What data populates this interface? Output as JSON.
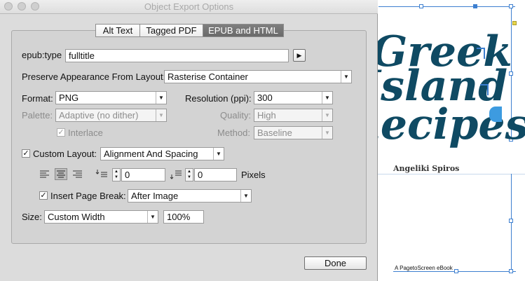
{
  "window": {
    "title": "Object Export Options"
  },
  "tabs": [
    {
      "label": "Alt Text"
    },
    {
      "label": "Tagged PDF"
    },
    {
      "label": "EPUB and HTML"
    }
  ],
  "epub_type": {
    "label": "epub:type",
    "value": "fulltitle"
  },
  "preserve": {
    "label": "Preserve Appearance From Layout:",
    "value": "Rasterise Container"
  },
  "format": {
    "label": "Format:",
    "value": "PNG"
  },
  "resolution": {
    "label": "Resolution (ppi):",
    "value": "300"
  },
  "palette": {
    "label": "Palette:",
    "value": "Adaptive (no dither)"
  },
  "quality": {
    "label": "Quality:",
    "value": "High"
  },
  "interlace": {
    "label": "Interlace",
    "checked": true
  },
  "method": {
    "label": "Method:",
    "value": "Baseline"
  },
  "custom_layout": {
    "label": "Custom Layout:",
    "checked": true,
    "value": "Alignment And Spacing"
  },
  "spacing": {
    "before": "0",
    "after": "0",
    "unit": "Pixels"
  },
  "page_break": {
    "label": "Insert Page Break:",
    "checked": true,
    "value": "After Image"
  },
  "size": {
    "label": "Size:",
    "value": "Custom Width",
    "percent": "100%"
  },
  "buttons": {
    "done": "Done"
  },
  "canvas": {
    "title_lines": [
      "Greek",
      "Island",
      "Recipes"
    ],
    "author": "Angeliki Spiros",
    "footer": "A PagetoScreen eBook"
  },
  "colors": {
    "accent": "#3d7fd0",
    "title_text": "#0f4a63",
    "tab_selected": "#737373"
  }
}
